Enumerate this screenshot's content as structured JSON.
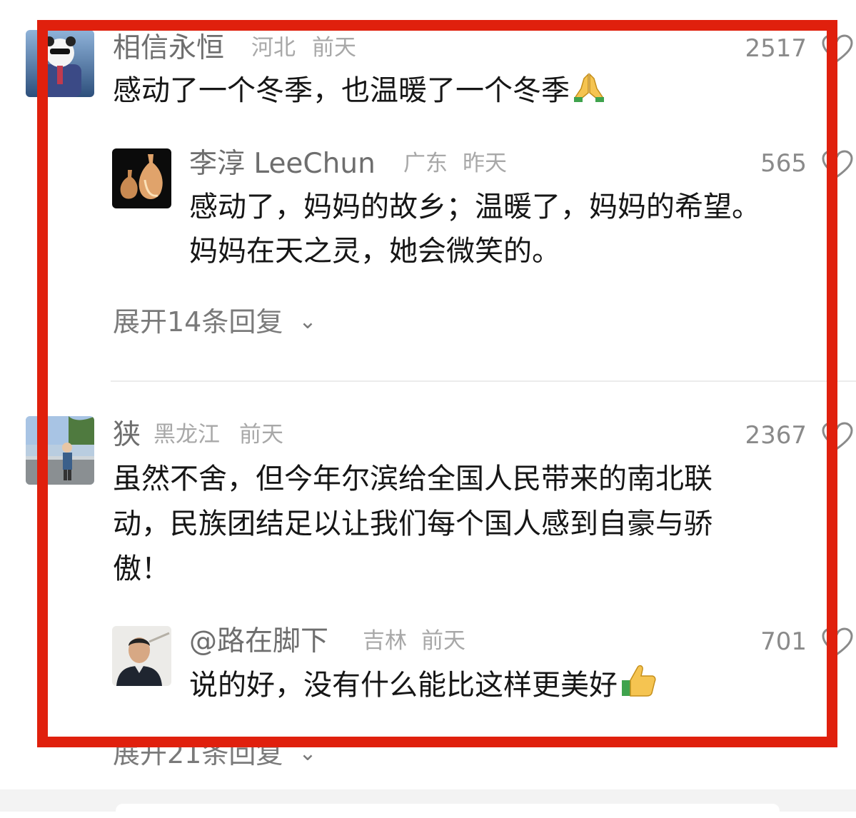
{
  "comments": [
    {
      "username": "相信永恒",
      "location": "河北",
      "time": "前天",
      "likes": "2517",
      "text": "感动了一个冬季，也温暖了一个冬季",
      "emoji_icon": "folded-hands-icon",
      "reply": {
        "username": "李淳 LeeChun",
        "location": "广东",
        "time": "昨天",
        "likes": "565",
        "text_line1": "感动了，妈妈的故乡；温暖了，妈妈的希望。",
        "text_line2": "妈妈在天之灵，她会微笑的。"
      },
      "expand_label": "展开14条回复"
    },
    {
      "username": "狭",
      "location": "黑龙江",
      "time": "前天",
      "likes": "2367",
      "text_line1": "虽然不舍，但今年尔滨给全国人民带来的南北联",
      "text_line2": "动，民族团结足以让我们每个国人感到自豪与骄",
      "text_line3": "傲！",
      "reply": {
        "username": "@路在脚下",
        "location": "吉林",
        "time": "前天",
        "likes": "701",
        "text": "说的好，没有什么能比这样更美好",
        "emoji_icon": "thumbs-up-icon"
      },
      "expand_label": "展开21条回复"
    }
  ],
  "colors": {
    "highlight_frame": "#e0200d",
    "username": "#6e6e6e",
    "meta": "#a8a8a8",
    "body_text": "#161616"
  }
}
